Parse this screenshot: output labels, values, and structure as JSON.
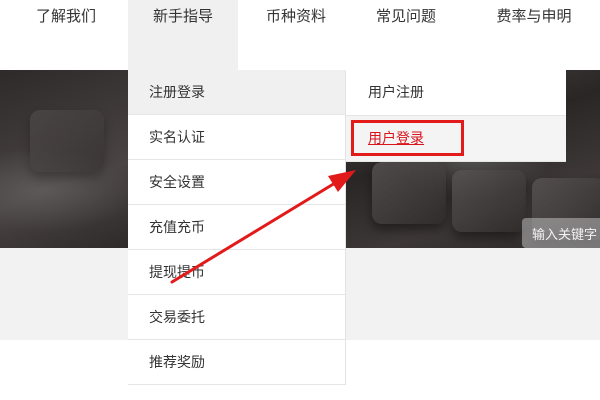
{
  "nav": {
    "items": [
      {
        "label": "了解我们"
      },
      {
        "label": "新手指导"
      },
      {
        "label": "币种资料"
      },
      {
        "label": "常见问题"
      },
      {
        "label": "费率与申明"
      }
    ],
    "active_index": 1
  },
  "dropdown": {
    "items": [
      {
        "label": "注册登录"
      },
      {
        "label": "实名认证"
      },
      {
        "label": "安全设置"
      },
      {
        "label": "充值充币"
      },
      {
        "label": "提现提币"
      },
      {
        "label": "交易委托"
      },
      {
        "label": "推荐奖励"
      }
    ],
    "active_index": 0
  },
  "submenu": {
    "items": [
      {
        "label": "用户注册"
      },
      {
        "label": "用户登录"
      }
    ],
    "hovered_index": 1
  },
  "hero": {
    "search_placeholder": "输入关键字"
  },
  "annotation": {
    "color": "#e21a1a"
  }
}
